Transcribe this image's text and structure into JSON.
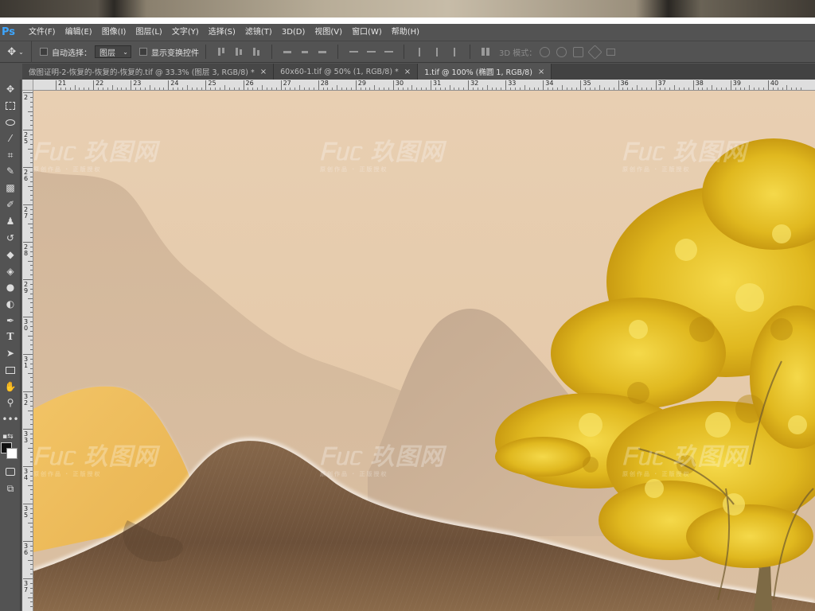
{
  "app": {
    "logo": "Ps"
  },
  "menu": [
    "文件(F)",
    "编辑(E)",
    "图像(I)",
    "图层(L)",
    "文字(Y)",
    "选择(S)",
    "滤镜(T)",
    "3D(D)",
    "视图(V)",
    "窗口(W)",
    "帮助(H)"
  ],
  "options": {
    "move_icon": "move-icon",
    "auto_select_label": "自动选择：",
    "auto_select_value": "图层",
    "show_transform_label": "显示变换控件",
    "mode_3d_label": "3D 模式："
  },
  "tabs": [
    {
      "title": "做图证明-2-恢复的-恢复的-恢复的.tif @ 33.3% (图层 3, RGB/8) *",
      "active": false
    },
    {
      "title": "60x60-1.tif @ 50% (1, RGB/8) *",
      "active": false
    },
    {
      "title": "1.tif @ 100% (椭圆 1, RGB/8)",
      "active": true
    }
  ],
  "tab_close": "×",
  "ruler_top": [
    "21",
    "22",
    "23",
    "24",
    "25",
    "26",
    "27",
    "28",
    "29",
    "30",
    "31",
    "32",
    "33",
    "34",
    "35",
    "36",
    "37",
    "38",
    "39",
    "40"
  ],
  "ruler_left": [
    "2",
    "2\n5",
    "2\n6",
    "2\n7",
    "2\n8",
    "2\n9",
    "3\n0",
    "3\n1",
    "3\n2",
    "3\n3",
    "3\n4",
    "3\n5",
    "3\n6",
    "3\n7"
  ],
  "watermark": {
    "brand": "ᖴᥙᥴ 玖图网",
    "sub": "原创作品 · 正版授权"
  },
  "tools": [
    "move-icon",
    "marquee-icon",
    "lasso-icon",
    "magic-wand-icon",
    "crop-icon",
    "eyedropper-icon",
    "healing-brush-icon",
    "brush-icon",
    "stamp-icon",
    "history-brush-icon",
    "eraser-icon",
    "paint-bucket-icon",
    "blur-icon",
    "dodge-icon",
    "pen-icon",
    "type-icon",
    "path-select-icon",
    "rectangle-icon",
    "hand-icon",
    "zoom-icon",
    "more-icon"
  ],
  "colors": {
    "canvas_bg": "#e6cbac",
    "ui_bg": "#535353",
    "accent": "#3da6ff",
    "gold_tree": "#e8c22a"
  }
}
